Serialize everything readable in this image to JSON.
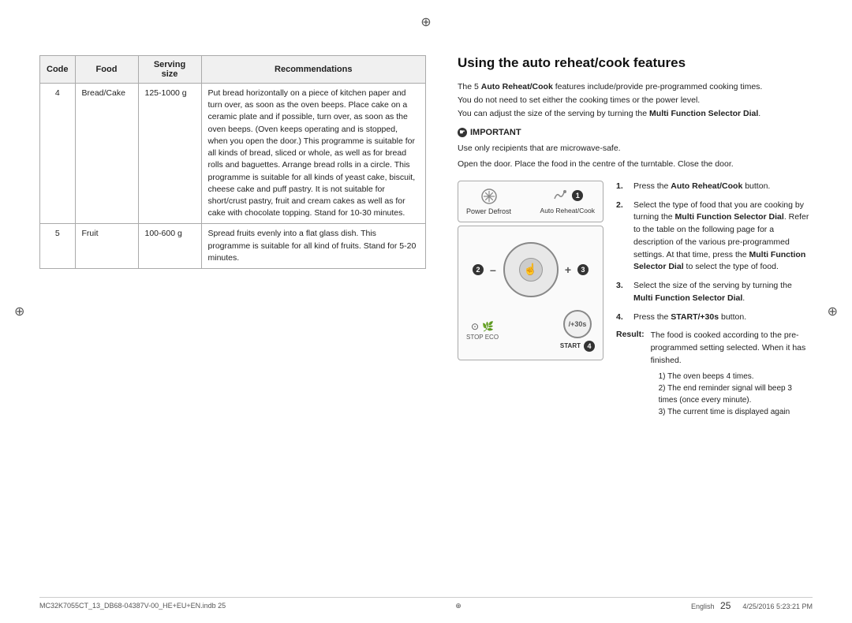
{
  "page": {
    "top_dot": "⊕",
    "left_dot": "⊕",
    "right_dot": "⊕"
  },
  "table": {
    "headers": [
      "Code",
      "Food",
      "Serving size",
      "Recommendations"
    ],
    "rows": [
      {
        "code": "4",
        "food": "Bread/Cake",
        "serving": "125-1000 g",
        "recommendation": "Put bread horizontally on a piece of kitchen paper and turn over, as soon as the oven beeps. Place cake on a ceramic plate and if possible, turn over, as soon as the oven beeps. (Oven keeps operating and is stopped, when you open the door.) This programme is suitable for all kinds of bread, sliced or whole, as well as for bread rolls and baguettes. Arrange bread rolls in a circle. This programme is suitable for all kinds of yeast cake, biscuit, cheese cake and puff pastry. It is not suitable for short/crust pastry, fruit and cream cakes as well as for cake with chocolate topping. Stand for 10-30 minutes."
      },
      {
        "code": "5",
        "food": "Fruit",
        "serving": "100-600 g",
        "recommendation": "Spread fruits evenly into a flat glass dish. This programme is suitable for all kind of fruits. Stand for 5-20 minutes."
      }
    ]
  },
  "right": {
    "title": "Using the auto reheat/cook features",
    "intro_line1": "The 5 Auto Reheat/Cook features include/provide pre-programmed cooking times.",
    "intro_line2": "You do not need to set either the cooking times or the power level.",
    "intro_line3": "You can adjust the size of the serving by turning the Multi Function Selector Dial.",
    "important_label": "IMPORTANT",
    "info1": "Use only recipients that are microwave-safe.",
    "info2": "Open the door. Place the food in the centre of the turntable. Close the door.",
    "diagram": {
      "top_left_label": "Power Defrost",
      "top_right_label": "Auto Reheat/Cook",
      "badge1": "1",
      "badge2": "2",
      "badge3": "3",
      "badge4": "4",
      "minus": "–",
      "plus": "+",
      "start_label": "/+30s",
      "start_sub": "START",
      "stop_label": "STOP  ECO"
    },
    "steps": [
      {
        "num": "1.",
        "text": "Press the Auto Reheat/Cook button."
      },
      {
        "num": "2.",
        "text": "Select the type of food that you are cooking by turning the Multi Function Selector Dial. Refer to the table on the following page for a description of the various pre-programmed settings. At that time, press the Multi Function Selector Dial to select the type of food."
      },
      {
        "num": "3.",
        "text": "Select the size of the serving by turning the Multi Function Selector Dial."
      },
      {
        "num": "4.",
        "text": "Press the START/+30s button."
      }
    ],
    "result_label": "Result:",
    "result_text": "The food is cooked according to the pre-programmed setting selected. When it has finished.",
    "result_subitems": [
      "1)  The oven beeps 4 times.",
      "2)  The end reminder signal will beep 3 times (once every minute).",
      "3)  The current time is displayed again"
    ]
  },
  "footer": {
    "left_text": "MC32K7055CT_13_DB68-04387V-00_HE+EU+EN.indb   25",
    "language": "English",
    "page_number": "25",
    "right_date": "4/25/2016   5:23:21 PM"
  }
}
